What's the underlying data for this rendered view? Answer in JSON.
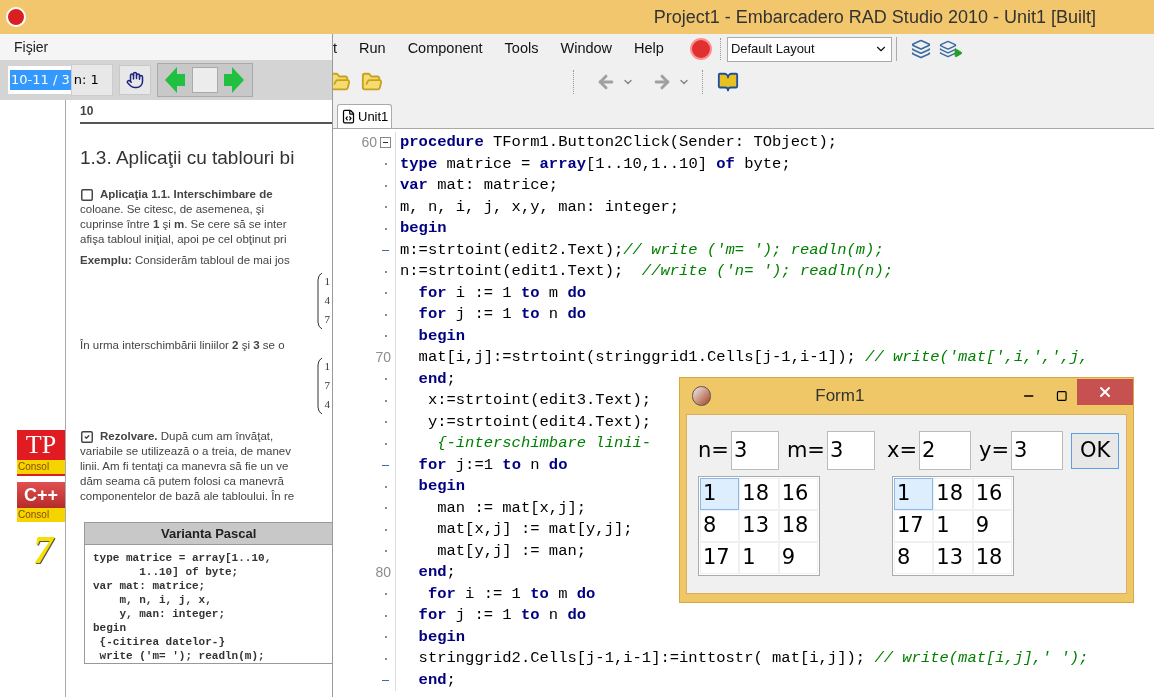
{
  "title_bar": {
    "title": "Project1 - Embarcadero RAD Studio 2010 - Unit1 [Built]"
  },
  "pdf_viewer": {
    "menu": [
      "Fişier"
    ],
    "page_field": {
      "value": "10-11 / 3",
      "selected": true
    },
    "zoom_field": {
      "value": "n: 1"
    },
    "launchers": [
      {
        "kind": "tp",
        "glyph": "TP",
        "caption": "Consol"
      },
      {
        "kind": "cpp",
        "glyph": "C++",
        "caption": "Consol"
      },
      {
        "kind": "seven",
        "glyph": "7"
      }
    ],
    "page": {
      "number": "10",
      "heading": "1.3. Aplicaţii cu tablouri bi",
      "task": {
        "checked": false,
        "lines": [
          "**Aplicaţia 1.1. Interschimbare de**",
          "coloane. Se citesc, de asemenea, şi",
          "cuprinse între **1** şi **m**. Se cere să se inter",
          "afişa tabloul iniţial, apoi pe cel obţinut pri"
        ]
      },
      "example": "**Exemplu:** Considerăm tabloul de mai jos",
      "matrix_1": [
        "1",
        "4",
        "7"
      ],
      "after": "În urma interschimbării liniilor **2** şi **3** se o",
      "matrix_2": [
        "1",
        "7",
        "4"
      ],
      "solution": {
        "checked": true,
        "lines": [
          "**Rezolvare.** După cum am învăţat,",
          "variabile se utilizează o a treia, de manev",
          "linii. Am fi tentaţi ca manevra să fie un ve",
          "dăm seama că putem folosi ca manevră",
          "componentelor de bază ale tabloului. În re"
        ]
      },
      "box": {
        "title": "Varianta Pascal",
        "code": [
          "type matrice = array[1..10,",
          "       1..10] of byte;",
          "var mat: matrice;",
          "    m, n, i, j, x,",
          "    y, man: integer;",
          "begin",
          " {-citirea datelor-}",
          " write ('m= '); readln(m);"
        ]
      }
    }
  },
  "ide": {
    "menu": [
      "t",
      "Run",
      "Component",
      "Tools",
      "Window",
      "Help"
    ],
    "layout_select": {
      "value": "Default Layout"
    },
    "tabs": [
      {
        "label": "Unit1",
        "selected": true
      }
    ],
    "code": [
      {
        "num": "60",
        "kind": "fold",
        "segs": [
          {
            "kind": "keyword",
            "text": "procedure"
          },
          {
            "kind": "plain",
            "text": " TForm1.Button2Click(Sender: TObject);"
          }
        ]
      },
      {
        "kind": "dot",
        "segs": [
          {
            "kind": "keyword",
            "text": "type"
          },
          {
            "kind": "plain",
            "text": " matrice = "
          },
          {
            "kind": "keyword",
            "text": "array"
          },
          {
            "kind": "plain",
            "text": "[1..10,1..10] "
          },
          {
            "kind": "keyword",
            "text": "of"
          },
          {
            "kind": "plain",
            "text": " byte;"
          }
        ]
      },
      {
        "kind": "dot",
        "segs": [
          {
            "kind": "keyword",
            "text": "var"
          },
          {
            "kind": "plain",
            "text": " mat: matrice;"
          }
        ]
      },
      {
        "kind": "dot",
        "segs": [
          {
            "kind": "plain",
            "text": "m, n, i, j, x,y, man: integer;"
          }
        ]
      },
      {
        "kind": "dot",
        "segs": [
          {
            "kind": "keyword",
            "text": "begin"
          }
        ]
      },
      {
        "kind": "dash",
        "segs": [
          {
            "kind": "plain",
            "text": "m:=strtoint(edit2.Text);"
          },
          {
            "kind": "comment",
            "text": "// write ('m= '); readln(m);"
          }
        ]
      },
      {
        "kind": "dot",
        "segs": [
          {
            "kind": "plain",
            "text": "n:=strtoint(edit1.Text);  "
          },
          {
            "kind": "comment",
            "text": "//write ('n= '); readln(n);"
          }
        ]
      },
      {
        "kind": "dot",
        "segs": [
          {
            "kind": "keyword",
            "text": "  for"
          },
          {
            "kind": "plain",
            "text": " i := 1 "
          },
          {
            "kind": "keyword",
            "text": "to"
          },
          {
            "kind": "plain",
            "text": " m "
          },
          {
            "kind": "keyword",
            "text": "do"
          }
        ]
      },
      {
        "kind": "dot",
        "segs": [
          {
            "kind": "keyword",
            "text": "  for"
          },
          {
            "kind": "plain",
            "text": " j := 1 "
          },
          {
            "kind": "keyword",
            "text": "to"
          },
          {
            "kind": "plain",
            "text": " n "
          },
          {
            "kind": "keyword",
            "text": "do"
          }
        ]
      },
      {
        "kind": "dot",
        "segs": [
          {
            "kind": "keyword",
            "text": "  begin"
          }
        ]
      },
      {
        "num": "70",
        "kind": "none",
        "segs": [
          {
            "kind": "plain",
            "text": "  mat[i,j]:=strtoint(stringgrid1.Cells[j-1,i-1]); "
          },
          {
            "kind": "comment",
            "text": "// write('mat[',i,',',j,"
          }
        ]
      },
      {
        "kind": "dot",
        "segs": [
          {
            "kind": "keyword",
            "text": "  end"
          },
          {
            "kind": "plain",
            "text": ";"
          }
        ]
      },
      {
        "kind": "dot",
        "segs": [
          {
            "kind": "plain",
            "text": "   x:=strtoint(edit3.Text);"
          }
        ]
      },
      {
        "kind": "dot",
        "segs": [
          {
            "kind": "plain",
            "text": "   y:=strtoint(edit4.Text);"
          }
        ]
      },
      {
        "kind": "dot",
        "segs": [
          {
            "kind": "comment",
            "text": "    {-interschimbare linii-"
          }
        ]
      },
      {
        "kind": "dash",
        "segs": [
          {
            "kind": "keyword",
            "text": "  for"
          },
          {
            "kind": "plain",
            "text": " j:=1 "
          },
          {
            "kind": "keyword",
            "text": "to"
          },
          {
            "kind": "plain",
            "text": " n "
          },
          {
            "kind": "keyword",
            "text": "do"
          }
        ]
      },
      {
        "kind": "dot",
        "segs": [
          {
            "kind": "keyword",
            "text": "  begin"
          }
        ]
      },
      {
        "kind": "dot",
        "segs": [
          {
            "kind": "plain",
            "text": "    man := mat[x,j];"
          }
        ]
      },
      {
        "kind": "dot",
        "segs": [
          {
            "kind": "plain",
            "text": "    mat[x,j] := mat[y,j];"
          }
        ]
      },
      {
        "kind": "dot",
        "segs": [
          {
            "kind": "plain",
            "text": "    mat[y,j] := man;"
          }
        ]
      },
      {
        "num": "80",
        "kind": "none",
        "segs": [
          {
            "kind": "keyword",
            "text": "  end"
          },
          {
            "kind": "plain",
            "text": ";"
          }
        ]
      },
      {
        "kind": "dot",
        "segs": [
          {
            "kind": "keyword",
            "text": "   for"
          },
          {
            "kind": "plain",
            "text": " i := 1 "
          },
          {
            "kind": "keyword",
            "text": "to"
          },
          {
            "kind": "plain",
            "text": " m "
          },
          {
            "kind": "keyword",
            "text": "do"
          }
        ]
      },
      {
        "kind": "dot",
        "segs": [
          {
            "kind": "keyword",
            "text": "  for"
          },
          {
            "kind": "plain",
            "text": " j := 1 "
          },
          {
            "kind": "keyword",
            "text": "to"
          },
          {
            "kind": "plain",
            "text": " n "
          },
          {
            "kind": "keyword",
            "text": "do"
          }
        ]
      },
      {
        "kind": "dot",
        "segs": [
          {
            "kind": "keyword",
            "text": "  begin"
          }
        ]
      },
      {
        "kind": "dot",
        "segs": [
          {
            "kind": "plain",
            "text": "  stringgrid2.Cells[j-1,i-1]:=inttostr( mat[i,j]); "
          },
          {
            "kind": "comment",
            "text": "// write(mat[i,j],' ');"
          }
        ]
      },
      {
        "kind": "dash",
        "segs": [
          {
            "kind": "keyword",
            "text": "  end"
          },
          {
            "kind": "plain",
            "text": ";"
          }
        ]
      }
    ]
  },
  "form": {
    "title": "Form1",
    "fields": [
      {
        "label": "n=",
        "value": "3"
      },
      {
        "label": "m=",
        "value": "3"
      },
      {
        "label": "x=",
        "value": "2"
      },
      {
        "label": "y=",
        "value": "3"
      }
    ],
    "ok": "OK",
    "grids": [
      {
        "rows": [
          [
            {
              "text": "1",
              "selected": true
            },
            {
              "text": "18",
              "selected": false
            },
            {
              "text": "16",
              "selected": false
            }
          ],
          [
            {
              "text": "8",
              "selected": false
            },
            {
              "text": "13",
              "selected": false
            },
            {
              "text": "18",
              "selected": false
            }
          ],
          [
            {
              "text": "17",
              "selected": false
            },
            {
              "text": "1",
              "selected": false
            },
            {
              "text": "9",
              "selected": false
            }
          ]
        ]
      },
      {
        "rows": [
          [
            {
              "text": "1",
              "selected": true
            },
            {
              "text": "18",
              "selected": false
            },
            {
              "text": "16",
              "selected": false
            }
          ],
          [
            {
              "text": "17",
              "selected": false
            },
            {
              "text": "1",
              "selected": false
            },
            {
              "text": "9",
              "selected": false
            }
          ],
          [
            {
              "text": "8",
              "selected": false
            },
            {
              "text": "13",
              "selected": false
            },
            {
              "text": "18",
              "selected": false
            }
          ]
        ]
      }
    ]
  }
}
